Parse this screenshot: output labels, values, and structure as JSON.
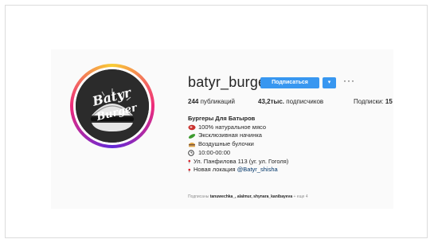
{
  "profile": {
    "username": "batyr_burger",
    "avatar_text_top": "Batyr",
    "avatar_text_bottom": "Burger",
    "follow_label": "Подписаться",
    "dropdown_icon": "chevron-down-icon",
    "more_label": "···",
    "stats": {
      "posts_count": "244",
      "posts_label": "публикаций",
      "followers_count": "43,2тыс.",
      "followers_label": "подписчиков",
      "following_label": "Подписки:",
      "following_count": "15"
    },
    "bio": {
      "name": "Бургеры Для Батыров",
      "lines": [
        {
          "icon": "steak-icon",
          "text": "100% натуральное мясо"
        },
        {
          "icon": "cucumber-icon",
          "text": "Эксклюзивная начинка"
        },
        {
          "icon": "burger-icon",
          "text": "Воздушные булочки"
        },
        {
          "icon": "clock-icon",
          "text": "10:00-00:00"
        },
        {
          "icon": "pin-icon",
          "text": "Ул. Панфилова 113 (уг. ул. Гоголя)"
        }
      ],
      "last_line_prefix": "Новая локация ",
      "last_line_mention": "@Batyr_shisha",
      "last_line_icon": "pin-icon"
    },
    "followed_by": {
      "prefix": "Подписаны",
      "users": "tanuwechka_, alalmur, shynara_kanibayeva",
      "suffix": "+ еще 4"
    }
  },
  "colors": {
    "accent": "#3897f0",
    "text": "#262626",
    "muted": "#8e8e8e",
    "card_bg": "#fafafa"
  }
}
